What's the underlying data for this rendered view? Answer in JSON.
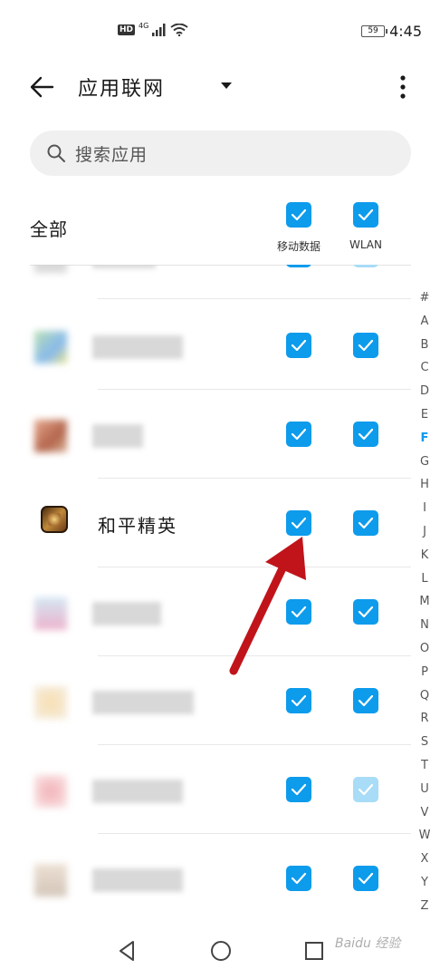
{
  "status_bar": {
    "hd": "HD",
    "network": "4G",
    "battery": "59",
    "time": "4:45"
  },
  "app_bar": {
    "title": "应用联网",
    "icons": [
      "back-arrow-icon",
      "dropdown-triangle-icon",
      "more-vert-icon"
    ]
  },
  "search": {
    "placeholder": "搜索应用"
  },
  "header": {
    "all_label": "全部",
    "mobile_data_label": "移动数据",
    "wlan_label": "WLAN"
  },
  "apps": [
    {
      "name": "",
      "mobile_data": true,
      "wlan": true,
      "blurred": true
    },
    {
      "name": "",
      "mobile_data": true,
      "wlan": true,
      "blurred": true
    },
    {
      "name": "和平精英",
      "mobile_data": true,
      "wlan": true,
      "blurred": false
    },
    {
      "name": "",
      "mobile_data": true,
      "wlan": true,
      "blurred": true
    },
    {
      "name": "",
      "mobile_data": true,
      "wlan": true,
      "blurred": true
    },
    {
      "name": "",
      "mobile_data": true,
      "wlan": true,
      "blurred": true
    },
    {
      "name": "",
      "mobile_data": true,
      "wlan": true,
      "blurred": true
    }
  ],
  "alpha_index": {
    "letters": [
      "#",
      "A",
      "B",
      "C",
      "D",
      "E",
      "F",
      "G",
      "H",
      "I",
      "J",
      "K",
      "L",
      "M",
      "N",
      "O",
      "P",
      "Q",
      "R",
      "S",
      "T",
      "U",
      "V",
      "W",
      "X",
      "Y",
      "Z"
    ],
    "active": "F"
  },
  "colors": {
    "accent": "#0d9bec",
    "accent_disabled": "#a8dcf7",
    "annotation_arrow": "#c0141a"
  },
  "watermark": "Baidu 经验"
}
